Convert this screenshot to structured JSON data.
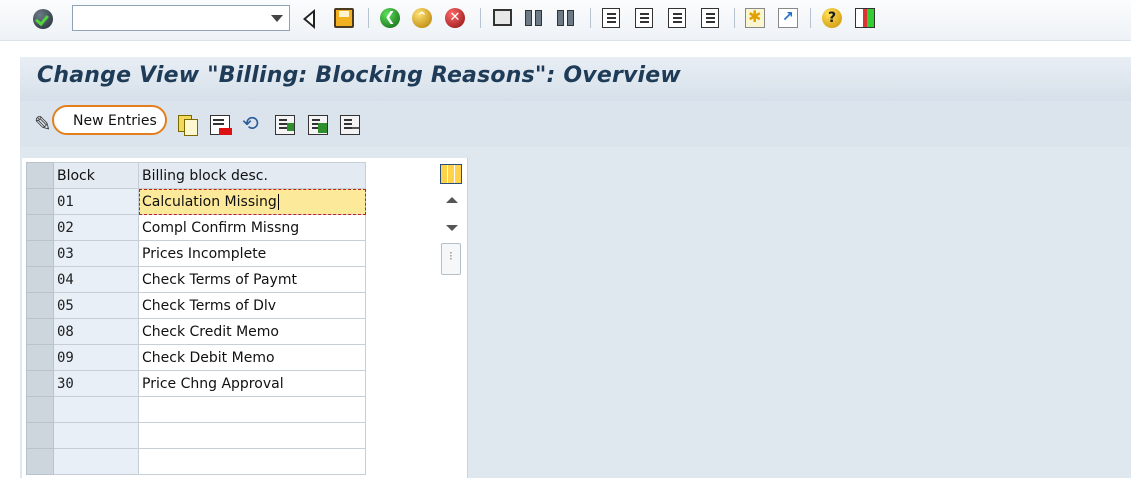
{
  "toolbar": {
    "command_field_value": "",
    "icons": [
      "enter-icon",
      "command-dropdown-icon",
      "back-triangle-icon",
      "save-icon",
      "back-icon",
      "exit-icon",
      "cancel-icon",
      "print-icon",
      "find-icon",
      "find-next-icon",
      "first-page-icon",
      "previous-page-icon",
      "next-page-icon",
      "last-page-icon",
      "new-session-icon",
      "shortcut-icon",
      "help-icon",
      "layout-menu-icon"
    ]
  },
  "title": "Change View \"Billing: Blocking Reasons\": Overview",
  "app_toolbar": {
    "new_entries_label": "New Entries",
    "icons": [
      "display-change-icon",
      "copy-as-icon",
      "delete-icon",
      "undo-change-icon",
      "select-all-icon",
      "select-block-icon",
      "deselect-all-icon"
    ]
  },
  "table": {
    "columns": [
      "Block",
      "Billing block desc."
    ],
    "rows": [
      {
        "block": "01",
        "desc": "Calculation Missing"
      },
      {
        "block": "02",
        "desc": "Compl Confirm Missng"
      },
      {
        "block": "03",
        "desc": "Prices Incomplete"
      },
      {
        "block": "04",
        "desc": "Check Terms of Paymt"
      },
      {
        "block": "05",
        "desc": "Check Terms of Dlv"
      },
      {
        "block": "08",
        "desc": "Check Credit Memo"
      },
      {
        "block": "09",
        "desc": "Check Debit Memo"
      },
      {
        "block": "30",
        "desc": "Price Chng Approval"
      }
    ]
  },
  "colors": {
    "title_text": "#1e3b58",
    "highlight_border": "#e3801d",
    "focused_cell": "#fce99a"
  }
}
